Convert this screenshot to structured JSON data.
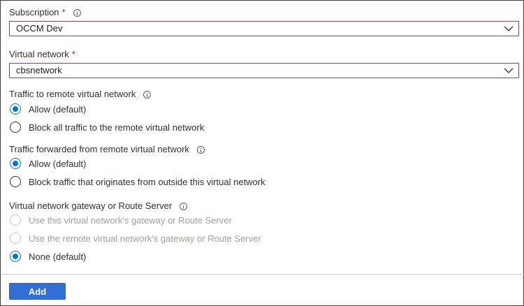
{
  "subscription": {
    "label": "Subscription",
    "required_mark": "*",
    "value": "OCCM Dev",
    "info_icon": "info-icon"
  },
  "virtual_network": {
    "label": "Virtual network",
    "required_mark": "*",
    "value": "cbsnetwork"
  },
  "traffic_to_remote": {
    "label": "Traffic to remote virtual network",
    "options": [
      {
        "label": "Allow (default)",
        "selected": true,
        "disabled": false
      },
      {
        "label": "Block all traffic to the remote virtual network",
        "selected": false,
        "disabled": false
      }
    ]
  },
  "traffic_forwarded": {
    "label": "Traffic forwarded from remote virtual network",
    "options": [
      {
        "label": "Allow (default)",
        "selected": true,
        "disabled": false
      },
      {
        "label": "Block traffic that originates from outside this virtual network",
        "selected": false,
        "disabled": false
      }
    ]
  },
  "gateway": {
    "label": "Virtual network gateway or Route Server",
    "options": [
      {
        "label": "Use this virtual network's gateway or Route Server",
        "selected": false,
        "disabled": true
      },
      {
        "label": "Use the remote virtual network's gateway or Route Server",
        "selected": false,
        "disabled": true
      },
      {
        "label": "None (default)",
        "selected": true,
        "disabled": false
      }
    ]
  },
  "actions": {
    "add_label": "Add"
  },
  "colors": {
    "accent": "#0078d4",
    "button": "#2f6fd6",
    "required": "#a4262c",
    "dropdown_border": "#8a3a8a",
    "disabled_text": "#a19f9d"
  }
}
